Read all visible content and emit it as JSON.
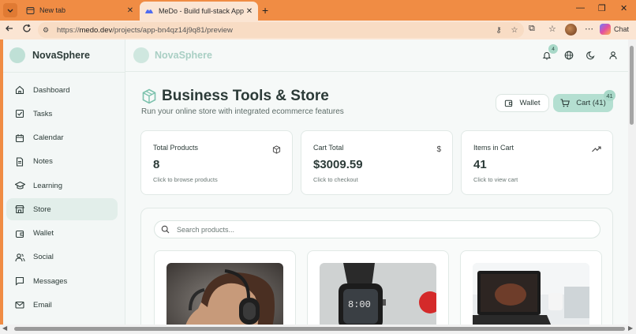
{
  "browser": {
    "tabs": [
      {
        "title": "New tab"
      },
      {
        "title": "MeDo - Build full-stack Apps With"
      }
    ],
    "url_prefix": "https://",
    "url_host": "medo.dev",
    "url_path": "/projects/app-bn4qz14j9q81/preview",
    "chat_label": "Chat"
  },
  "sidebar": {
    "brand": "NovaSphere",
    "items": [
      {
        "label": "Dashboard",
        "icon": "home-icon"
      },
      {
        "label": "Tasks",
        "icon": "checkbox-icon"
      },
      {
        "label": "Calendar",
        "icon": "calendar-icon"
      },
      {
        "label": "Notes",
        "icon": "note-icon"
      },
      {
        "label": "Learning",
        "icon": "graduation-cap-icon"
      },
      {
        "label": "Store",
        "icon": "store-icon",
        "active": true
      },
      {
        "label": "Wallet",
        "icon": "wallet-icon"
      },
      {
        "label": "Social",
        "icon": "users-icon"
      },
      {
        "label": "Messages",
        "icon": "message-icon"
      },
      {
        "label": "Email",
        "icon": "mail-icon"
      }
    ]
  },
  "topbar": {
    "brand": "NovaSphere",
    "notification_count": "4"
  },
  "page": {
    "title": "Business Tools & Store",
    "subtitle": "Run your online store with integrated ecommerce features",
    "wallet_label": "Wallet",
    "cart_label": "Cart (41)",
    "cart_badge": "41"
  },
  "stats": [
    {
      "label": "Total Products",
      "value": "8",
      "hint": "Click to browse products",
      "icon": "box-icon"
    },
    {
      "label": "Cart Total",
      "value": "$3009.59",
      "hint": "Click to checkout",
      "icon": "dollar-icon"
    },
    {
      "label": "Items in Cart",
      "value": "41",
      "hint": "Click to view cart",
      "icon": "trending-up-icon"
    }
  ],
  "search": {
    "placeholder": "Search products..."
  },
  "colors": {
    "accent": "#b4dfd1",
    "browser": "#f08c44"
  }
}
